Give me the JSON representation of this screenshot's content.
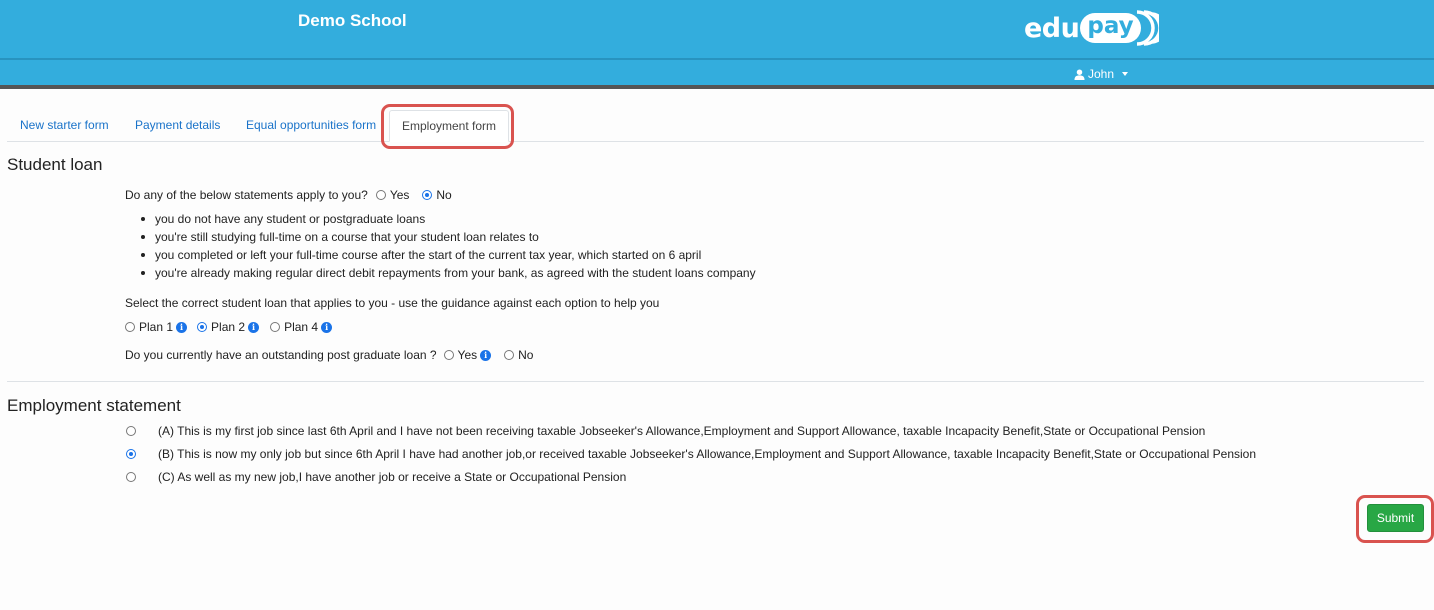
{
  "header": {
    "school_name": "Demo School",
    "logo_left": "edu",
    "logo_right": "pay",
    "user_name": "John"
  },
  "tabs": [
    {
      "label": "New starter form",
      "active": false
    },
    {
      "label": "Payment details",
      "active": false
    },
    {
      "label": "Equal opportunities form",
      "active": false
    },
    {
      "label": "Employment form",
      "active": true
    }
  ],
  "student_loan": {
    "title": "Student loan",
    "question1": "Do any of the below statements apply to you?",
    "q1_yes": "Yes",
    "q1_no": "No",
    "q1_selected": "No",
    "bullets": [
      "you do not have any student or postgraduate loans",
      "you're still studying full-time on a course that your student loan relates to",
      "you completed or left your full-time course after the start of the current tax year, which started on 6 april",
      "you're already making regular direct debit repayments from your bank, as agreed with the student loans company"
    ],
    "plan_prompt": "Select the correct student loan that applies to you - use the guidance against each option to help you",
    "plans": [
      "Plan 1",
      "Plan 2",
      "Plan 4"
    ],
    "plan_selected": "Plan 2",
    "postgrad_question": "Do you currently have an outstanding post graduate loan ?",
    "postgrad_yes": "Yes",
    "postgrad_no": "No"
  },
  "employment": {
    "title": "Employment statement",
    "statements": [
      "(A) This is my first job since last 6th April and I have not been receiving taxable Jobseeker's Allowance,Employment and Support Allowance, taxable Incapacity Benefit,State or Occupational Pension",
      "(B) This is now my only job but since 6th April I have had another job,or received taxable Jobseeker's Allowance,Employment and Support Allowance, taxable Incapacity Benefit,State or Occupational Pension",
      "(C) As well as my new job,I have another job or receive a State or Occupational Pension"
    ],
    "selected": "B"
  },
  "submit_label": "Submit",
  "colors": {
    "header": "#33addd",
    "link": "#1a73c9",
    "submit": "#28a745",
    "highlight": "#d9534f"
  }
}
